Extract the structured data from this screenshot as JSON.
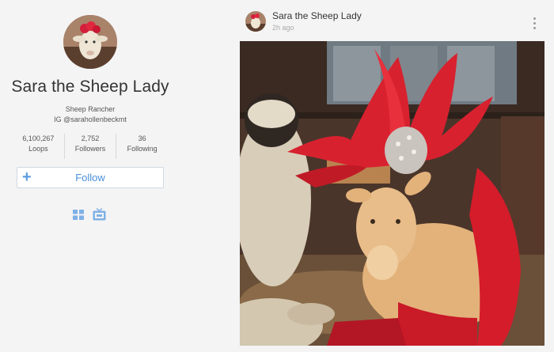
{
  "profile": {
    "name": "Sara the Sheep Lady",
    "bio_line1": "Sheep Rancher",
    "bio_line2": "IG @sarahollenbeckmt",
    "stats": [
      {
        "value": "6,100,267",
        "label": "Loops"
      },
      {
        "value": "2,752",
        "label": "Followers"
      },
      {
        "value": "36",
        "label": "Following"
      }
    ],
    "follow_label": "Follow",
    "follow_icon": "+",
    "view_icons": [
      "grid-icon",
      "tv-icon"
    ]
  },
  "post": {
    "author": "Sara the Sheep Lady",
    "time": "2h ago"
  },
  "colors": {
    "background": "#f4f4f4",
    "accent": "#4a90d9",
    "text": "#333333"
  }
}
